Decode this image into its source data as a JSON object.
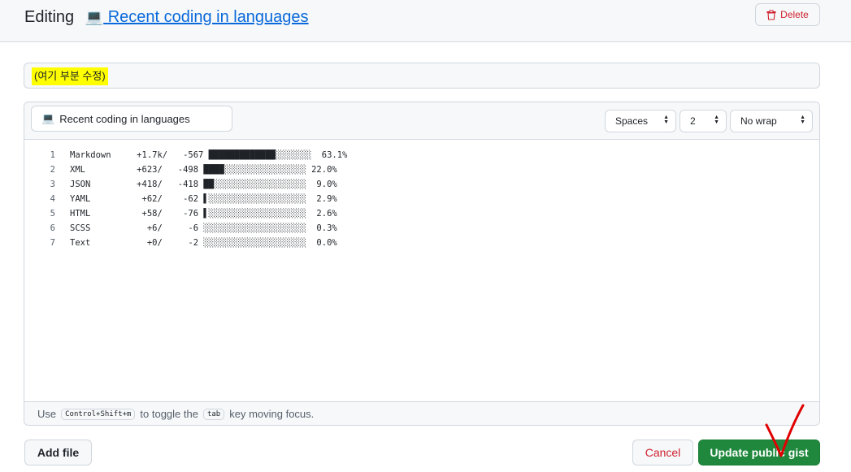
{
  "header": {
    "editing_label": "Editing",
    "laptop_icon": "💻",
    "gist_title": "Recent coding in languages",
    "delete_label": "Delete"
  },
  "description": {
    "value": "(여기 부분 수정)"
  },
  "editor": {
    "file_icon": "💻",
    "filename": "Recent coding in languages",
    "indent_mode": "Spaces",
    "indent_size": "2",
    "wrap_mode": "No wrap",
    "lines": [
      {
        "n": "1",
        "text": "Markdown     +1.7k/   -567 █████████████░░░░░░░  63.1%"
      },
      {
        "n": "2",
        "text": "XML          +623/   -498 ████░░░░░░░░░░░░░░░░ 22.0%"
      },
      {
        "n": "3",
        "text": "JSON         +418/   -418 ██░░░░░░░░░░░░░░░░░░  9.0%"
      },
      {
        "n": "4",
        "text": "YAML          +62/    -62 ▌░░░░░░░░░░░░░░░░░░░  2.9%"
      },
      {
        "n": "5",
        "text": "HTML          +58/    -76 ▌░░░░░░░░░░░░░░░░░░░  2.6%"
      },
      {
        "n": "6",
        "text": "SCSS           +6/     -6 ░░░░░░░░░░░░░░░░░░░░  0.3%"
      },
      {
        "n": "7",
        "text": "Text           +0/     -2 ░░░░░░░░░░░░░░░░░░░░  0.0%"
      }
    ],
    "footer": {
      "use": "Use",
      "shortcut": "Control+Shift+m",
      "to_toggle": "to toggle the",
      "tab_key": "tab",
      "moving_focus": "key moving focus."
    }
  },
  "actions": {
    "add_file": "Add file",
    "cancel": "Cancel",
    "update": "Update public gist"
  },
  "colors": {
    "accent_link": "#0969da",
    "danger": "#cf222e",
    "primary_green": "#1f883d",
    "highlight": "#ffff00",
    "annotation_red": "#e00000"
  }
}
